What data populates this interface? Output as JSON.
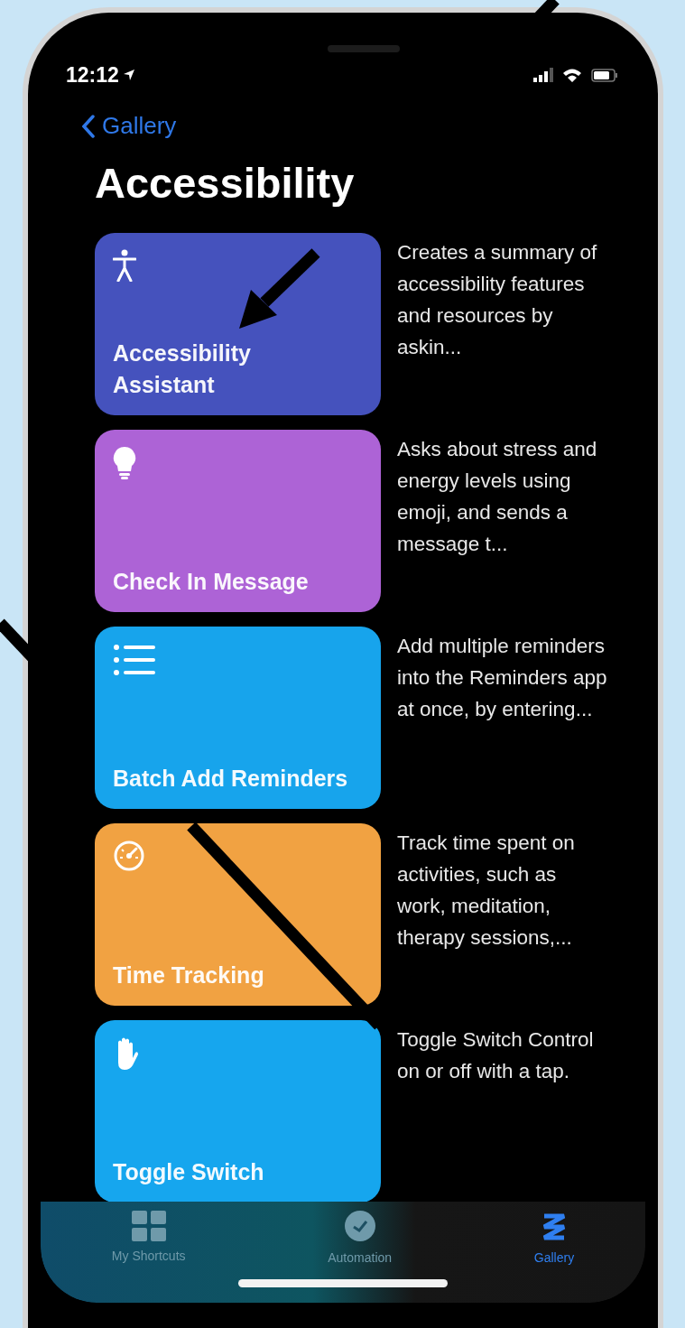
{
  "status_bar": {
    "time": "12:12"
  },
  "navigation": {
    "back_label": "Gallery"
  },
  "title": "Accessibility",
  "shortcuts": [
    {
      "name": "Accessibility Assistant",
      "description": "Creates a summary of accessibility features and resources by askin...",
      "color": "#4552bd"
    },
    {
      "name": "Check In Message",
      "description": "Asks about stress and energy levels using emoji, and sends a message t...",
      "color": "#ad63d6"
    },
    {
      "name": "Batch Add Reminders",
      "description": "Add multiple reminders into the Reminders app at once, by entering...",
      "color": "#17a4ec"
    },
    {
      "name": "Time Tracking",
      "description": "Track time spent on activities, such as work, meditation, therapy sessions,...",
      "color": "#f1a242"
    },
    {
      "name": "Toggle Switch",
      "description": "Toggle Switch Control on or off with a tap.",
      "color": "#16a6ee"
    }
  ],
  "tab_bar": [
    {
      "label": "My Shortcuts",
      "selected": false
    },
    {
      "label": "Automation",
      "selected": false
    },
    {
      "label": "Gallery",
      "selected": true
    }
  ]
}
